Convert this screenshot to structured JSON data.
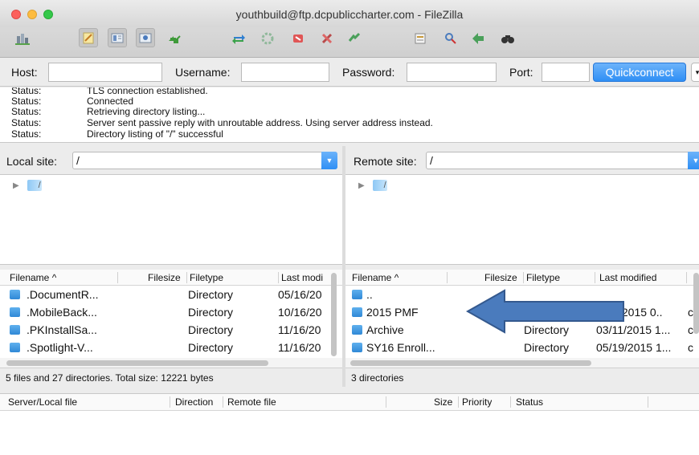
{
  "window": {
    "title": "youthbuild@ftp.dcpubliccharter.com - FileZilla"
  },
  "toolbar": {
    "icons": [
      "site-manager-icon",
      "toggle-log-icon",
      "toggle-local-tree-icon",
      "toggle-remote-tree-icon",
      "toggle-queue-icon",
      "refresh-icon",
      "process-queue-icon",
      "cancel-icon",
      "disconnect-icon",
      "reconnect-icon",
      "filter-icon",
      "compare-icon",
      "sync-browse-icon",
      "search-icon"
    ]
  },
  "quickconnect": {
    "host_label": "Host:",
    "host_value": "",
    "username_label": "Username:",
    "username_value": "",
    "password_label": "Password:",
    "password_value": "",
    "port_label": "Port:",
    "port_value": "",
    "button_label": "Quickconnect",
    "dropdown_glyph": "▾"
  },
  "log": [
    {
      "key": "Status:",
      "msg": "TLS connection established."
    },
    {
      "key": "Status:",
      "msg": "Connected"
    },
    {
      "key": "Status:",
      "msg": "Retrieving directory listing..."
    },
    {
      "key": "Status:",
      "msg": "Server sent passive reply with unroutable address. Using server address instead."
    },
    {
      "key": "Status:",
      "msg": "Directory listing of \"/\" successful"
    }
  ],
  "local": {
    "site_label": "Local site:",
    "site_value": "/",
    "tree_root": "/",
    "columns": {
      "filename": "Filename",
      "sort_glyph": "^",
      "filesize": "Filesize",
      "filetype": "Filetype",
      "last_modified": "Last modi"
    },
    "files": [
      {
        "name": ".DocumentR...",
        "size": "",
        "type": "Directory",
        "modified": "05/16/20"
      },
      {
        "name": ".MobileBack...",
        "size": "",
        "type": "Directory",
        "modified": "10/16/20"
      },
      {
        "name": ".PKInstallSa...",
        "size": "",
        "type": "Directory",
        "modified": "11/16/20"
      },
      {
        "name": ".Spotlight-V...",
        "size": "",
        "type": "Directory",
        "modified": "11/16/20"
      }
    ],
    "status": "5 files and 27 directories. Total size: 12221 bytes"
  },
  "remote": {
    "site_label": "Remote site:",
    "site_value": "/",
    "tree_root": "/",
    "columns": {
      "filename": "Filename",
      "sort_glyph": "^",
      "filesize": "Filesize",
      "filetype": "Filetype",
      "last_modified": "Last modified"
    },
    "files": [
      {
        "name": "..",
        "size": "",
        "type": "",
        "modified": "",
        "extra": ""
      },
      {
        "name": "2015 PMF",
        "size": "",
        "type": "",
        "modified": "/2015 0..",
        "extra": "c"
      },
      {
        "name": "Archive",
        "size": "",
        "type": "Directory",
        "modified": "03/11/2015 1...",
        "extra": "c"
      },
      {
        "name": "SY16 Enroll...",
        "size": "",
        "type": "Directory",
        "modified": "05/19/2015 1...",
        "extra": "c"
      }
    ],
    "status": "3 directories"
  },
  "queue": {
    "columns": {
      "server_local": "Server/Local file",
      "direction": "Direction",
      "remote_file": "Remote file",
      "size": "Size",
      "priority": "Priority",
      "status": "Status"
    }
  },
  "colors": {
    "accent": "#2f8ff5",
    "annotation_arrow": "#4a7bbd"
  }
}
